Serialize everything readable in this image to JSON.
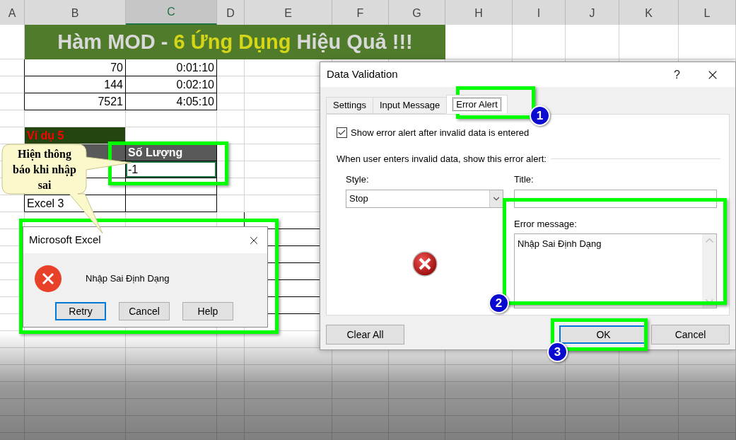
{
  "sheet": {
    "columns": [
      {
        "label": "A",
        "selected": false
      },
      {
        "label": "B",
        "selected": false
      },
      {
        "label": "C",
        "selected": true
      },
      {
        "label": "D",
        "selected": false
      },
      {
        "label": "E",
        "selected": false
      },
      {
        "label": "F",
        "selected": false
      },
      {
        "label": "G",
        "selected": false
      },
      {
        "label": "H",
        "selected": false
      },
      {
        "label": "I",
        "selected": false
      },
      {
        "label": "J",
        "selected": false
      },
      {
        "label": "K",
        "selected": false
      },
      {
        "label": "L",
        "selected": false
      }
    ],
    "banner": [
      {
        "text": "Hàm MOD - ",
        "highlight": false
      },
      {
        "text": "6 Ứng Dụng",
        "highlight": true
      },
      {
        "text": " Hiệu Quả !!!",
        "highlight": false
      }
    ],
    "rows": [
      {
        "kind": "data",
        "b": "70",
        "c": "0:01:10"
      },
      {
        "kind": "data",
        "b": "144",
        "c": "0:02:10"
      },
      {
        "kind": "data",
        "b": "7521",
        "c": "4:05:10"
      },
      {
        "kind": "blank"
      },
      {
        "kind": "label",
        "b": "Ví dụ 5"
      },
      {
        "kind": "header",
        "c": "Số Lượng"
      },
      {
        "kind": "input",
        "c": "-1",
        "selected": true
      },
      {
        "kind": "data"
      },
      {
        "kind": "text",
        "b": "Excel 3"
      },
      {
        "kind": "table_e"
      },
      {
        "kind": "table_e"
      },
      {
        "kind": "table_e"
      },
      {
        "kind": "table_e"
      },
      {
        "kind": "table_e"
      },
      {
        "kind": "table_e"
      }
    ]
  },
  "callout": {
    "text": "Hiện thông báo khi nhập sai"
  },
  "message_box": {
    "title": "Microsoft Excel",
    "message": "Nhập Sai Định Dạng",
    "buttons": [
      {
        "label": "Retry",
        "default": true
      },
      {
        "label": "Cancel",
        "default": false
      },
      {
        "label": "Help",
        "default": false
      }
    ]
  },
  "data_validation": {
    "title": "Data Validation",
    "help": "?",
    "tabs": [
      {
        "label": "Settings",
        "selected": false
      },
      {
        "label": "Input Message",
        "selected": false
      },
      {
        "label": "Error Alert",
        "selected": true
      }
    ],
    "show_alert": {
      "label": "Show error alert after invalid data is entered",
      "checked": true
    },
    "group_label": "When user enters invalid data, show this error alert:",
    "style": {
      "label": "Style:",
      "value": "Stop"
    },
    "title_field": {
      "label": "Title:"
    },
    "error_message": {
      "label": "Error message:",
      "value": "Nhập Sai Định Dạng"
    },
    "buttons": [
      {
        "label": "Clear All",
        "default": false
      },
      {
        "label": "OK",
        "default": true
      },
      {
        "label": "Cancel",
        "default": false
      }
    ]
  },
  "steps": [
    "1",
    "2",
    "3"
  ]
}
